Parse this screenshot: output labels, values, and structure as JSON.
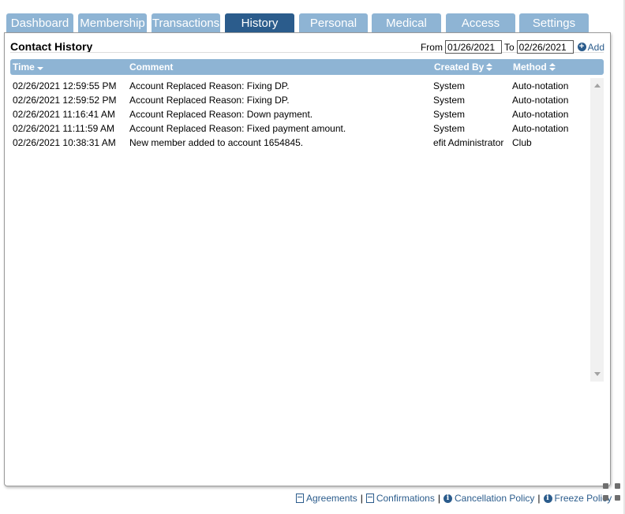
{
  "tabs": [
    {
      "label": "Dashboard",
      "active": false
    },
    {
      "label": "Membership",
      "active": false
    },
    {
      "label": "Transactions",
      "active": false
    },
    {
      "label": "History",
      "active": true
    },
    {
      "label": "Personal",
      "active": false
    },
    {
      "label": "Medical",
      "active": false
    },
    {
      "label": "Access",
      "active": false
    },
    {
      "label": "Settings",
      "active": false
    }
  ],
  "panel": {
    "title": "Contact History",
    "from_label": "From",
    "from_value": "01/26/2021",
    "to_label": "To",
    "to_value": "02/26/2021",
    "add_label": "Add"
  },
  "grid": {
    "columns": [
      "Time",
      "Comment",
      "Created By",
      "Method"
    ],
    "rows": [
      {
        "time": "02/26/2021 12:59:55 PM",
        "comment": "Account Replaced Reason: Fixing DP.",
        "created_by": "System",
        "method": "Auto-notation"
      },
      {
        "time": "02/26/2021 12:59:52 PM",
        "comment": "Account Replaced Reason: Fixing DP.",
        "created_by": "System",
        "method": "Auto-notation"
      },
      {
        "time": "02/26/2021 11:16:41 AM",
        "comment": "Account Replaced Reason: Down payment.",
        "created_by": "System",
        "method": "Auto-notation"
      },
      {
        "time": "02/26/2021 11:11:59 AM",
        "comment": "Account Replaced Reason: Fixed payment amount.",
        "created_by": "System",
        "method": "Auto-notation"
      },
      {
        "time": "02/26/2021 10:38:31 AM",
        "comment": "New member added to account 1654845.",
        "created_by": "efit Administrator",
        "method": "Club"
      }
    ]
  },
  "footer": {
    "agreements": "Agreements",
    "confirmations": "Confirmations",
    "cancellation": "Cancellation Policy",
    "freeze": "Freeze Policy",
    "separator": "|"
  },
  "colors": {
    "tab": "#8eb4d4",
    "tab_active": "#2b5c8c",
    "link": "#2b5c8c"
  }
}
